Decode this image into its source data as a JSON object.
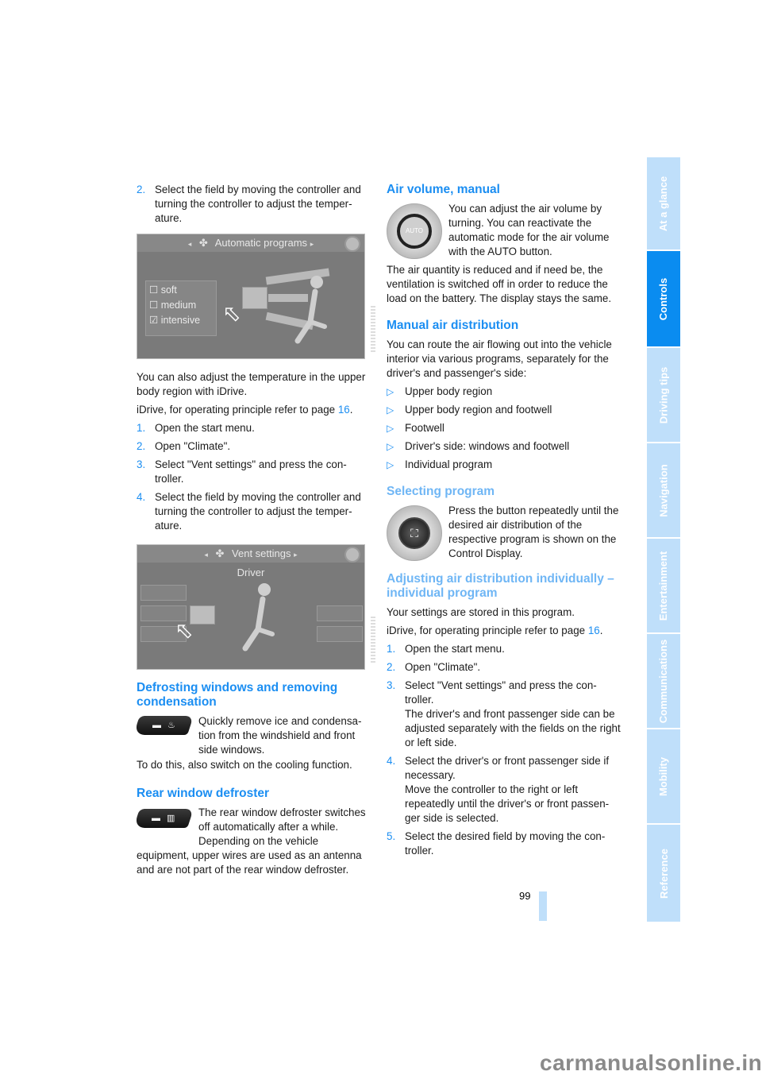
{
  "left_column": {
    "step2": {
      "num": "2.",
      "text": "Select the field by moving the controller and turning the controller to adjust the temper-ature."
    },
    "screen1": {
      "title": "Automatic programs",
      "options": [
        "soft",
        "medium",
        "intensive"
      ],
      "checked_option": "intensive",
      "prefix_unchecked": "☐",
      "prefix_checked": "☑"
    },
    "para1": "You can also adjust the temperature in the upper body region with iDrive.",
    "para2_prefix": "iDrive, for operating principle refer to page ",
    "para2_link": "16",
    "para2_suffix": ".",
    "steps": [
      {
        "num": "1.",
        "text": "Open the start menu."
      },
      {
        "num": "2.",
        "text": "Open \"Climate\"."
      },
      {
        "num": "3.",
        "text": "Select \"Vent settings\" and press the con-troller."
      },
      {
        "num": "4.",
        "text": "Select the field by moving the controller and turning the controller to adjust the temper-ature."
      }
    ],
    "screen2": {
      "title": "Vent settings",
      "subtitle": "Driver"
    },
    "defrost": {
      "heading": "Defrosting windows and removing condensation",
      "text": "Quickly remove ice and condensa-tion from the windshield and front side windows.",
      "note": "To do this, also switch on the cooling function."
    },
    "rear": {
      "heading": "Rear window defroster",
      "text": "The rear window defroster switches off automatically after a while. Depending on the vehicle equipment, upper wires are used as an antenna and are not part of the rear window defroster."
    }
  },
  "right_column": {
    "air_volume": {
      "heading": "Air volume, manual",
      "text": "You can adjust the air volume by turning. You can reactivate the automatic mode for the air volume with the AUTO button.",
      "note": "The air quantity is reduced and if need be, the ventilation is switched off in order to reduce the load on the battery. The display stays the same.",
      "knob_label": "AUTO"
    },
    "manual_dist": {
      "heading": "Manual air distribution",
      "text": "You can route the air flowing out into the vehicle interior via various programs, separately for the driver's and passenger's side:",
      "bullet_glyph": "▷",
      "bullets": [
        "Upper body region",
        "Upper body region and footwell",
        "Footwell",
        "Driver's side: windows and footwell",
        "Individual program"
      ]
    },
    "selecting": {
      "heading": "Selecting program",
      "text": "Press the button repeatedly until the desired air distribution of the respective program is shown on the Control Display."
    },
    "adjusting": {
      "heading": "Adjusting air distribution individually – individual program",
      "para1": "Your settings are stored in this program.",
      "para2_prefix": "iDrive, for operating principle refer to page ",
      "para2_link": "16",
      "para2_suffix": ".",
      "steps": [
        {
          "num": "1.",
          "text": "Open the start menu."
        },
        {
          "num": "2.",
          "text": "Open \"Climate\"."
        },
        {
          "num": "3.",
          "text": "Select \"Vent settings\" and press the con-troller.",
          "extra": "The driver's and front passenger side can be adjusted separately with the fields on the right or left side."
        },
        {
          "num": "4.",
          "text": "Select the driver's or front passenger side if necessary.",
          "extra": "Move the controller to the right or left repeatedly until the driver's or front passen-ger side is selected."
        },
        {
          "num": "5.",
          "text": "Select the desired field by moving the con-troller."
        }
      ]
    }
  },
  "side_tabs": [
    "At a glance",
    "Controls",
    "Driving tips",
    "Navigation",
    "Entertainment",
    "Communications",
    "Mobility",
    "Reference"
  ],
  "active_tab": "Controls",
  "page_number": "99",
  "site_watermark": "carmanualsonline.info",
  "colors": {
    "accent": "#1b8ef2",
    "tab_active": "#0a8cf0",
    "tab_inactive": "#bfdffa"
  }
}
